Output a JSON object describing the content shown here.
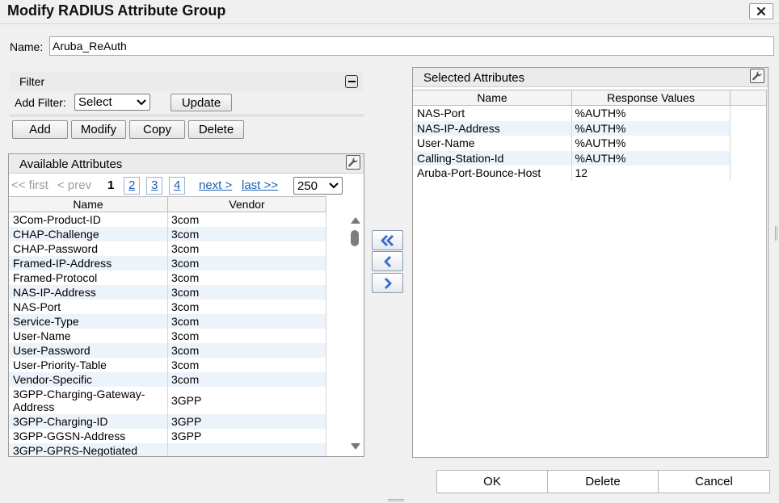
{
  "dialog": {
    "title": "Modify RADIUS Attribute Group",
    "close_icon": "close-icon"
  },
  "name": {
    "label": "Name:",
    "value": "Aruba_ReAuth"
  },
  "filter": {
    "title": "Filter",
    "add_filter_label": "Add Filter:",
    "select_value": "Select",
    "update_label": "Update"
  },
  "actions": {
    "add": "Add",
    "modify": "Modify",
    "copy": "Copy",
    "delete": "Delete"
  },
  "available": {
    "title": "Available Attributes",
    "pager": {
      "first": "<< first",
      "prev": "< prev",
      "pages": [
        "1",
        "2",
        "3",
        "4"
      ],
      "current": "1",
      "next": "next >",
      "last": "last >>",
      "page_size": "250"
    },
    "columns": [
      "Name",
      "Vendor"
    ],
    "rows": [
      [
        "3Com-Product-ID",
        "3com"
      ],
      [
        "CHAP-Challenge",
        "3com"
      ],
      [
        "CHAP-Password",
        "3com"
      ],
      [
        "Framed-IP-Address",
        "3com"
      ],
      [
        "Framed-Protocol",
        "3com"
      ],
      [
        "NAS-IP-Address",
        "3com"
      ],
      [
        "NAS-Port",
        "3com"
      ],
      [
        "Service-Type",
        "3com"
      ],
      [
        "User-Name",
        "3com"
      ],
      [
        "User-Password",
        "3com"
      ],
      [
        "User-Priority-Table",
        "3com"
      ],
      [
        "Vendor-Specific",
        "3com"
      ],
      [
        "3GPP-Charging-Gateway-Address",
        "3GPP"
      ],
      [
        "3GPP-Charging-ID",
        "3GPP"
      ],
      [
        "3GPP-GGSN-Address",
        "3GPP"
      ],
      [
        "3GPP-GPRS-Negotiated",
        ""
      ]
    ]
  },
  "selected": {
    "title": "Selected Attributes",
    "columns": [
      "Name",
      "Response Values"
    ],
    "rows": [
      [
        "NAS-Port",
        "%AUTH%"
      ],
      [
        "NAS-IP-Address",
        "%AUTH%"
      ],
      [
        "User-Name",
        "%AUTH%"
      ],
      [
        "Calling-Station-Id",
        "%AUTH%"
      ],
      [
        "Aruba-Port-Bounce-Host",
        "12"
      ]
    ]
  },
  "footer": {
    "ok": "OK",
    "delete": "Delete",
    "cancel": "Cancel"
  },
  "colors": {
    "link": "#1a5fb4",
    "arrow": "#3a6fd0",
    "row_alt": "#edf3fb"
  }
}
